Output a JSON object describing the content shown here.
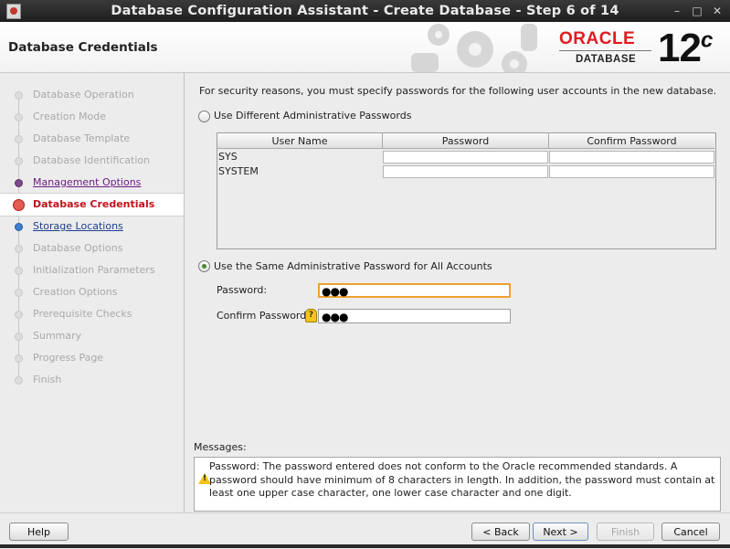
{
  "window": {
    "title": "Database Configuration Assistant - Create Database - Step 6 of 14",
    "controls": {
      "minimize": "–",
      "maximize": "□",
      "close": "✕"
    }
  },
  "header": {
    "page_title": "Database Credentials",
    "brand": {
      "oracle": "ORACLE",
      "database": "DATABASE",
      "version": "12",
      "version_suffix": "c"
    }
  },
  "steps": [
    {
      "label": "Database Operation",
      "state": "disabled"
    },
    {
      "label": "Creation Mode",
      "state": "disabled"
    },
    {
      "label": "Database Template",
      "state": "disabled"
    },
    {
      "label": "Database Identification",
      "state": "disabled"
    },
    {
      "label": "Management Options",
      "state": "visited"
    },
    {
      "label": "Database Credentials",
      "state": "current"
    },
    {
      "label": "Storage Locations",
      "state": "link"
    },
    {
      "label": "Database Options",
      "state": "disabled"
    },
    {
      "label": "Initialization Parameters",
      "state": "disabled"
    },
    {
      "label": "Creation Options",
      "state": "disabled"
    },
    {
      "label": "Prerequisite Checks",
      "state": "disabled"
    },
    {
      "label": "Summary",
      "state": "disabled"
    },
    {
      "label": "Progress Page",
      "state": "disabled"
    },
    {
      "label": "Finish",
      "state": "disabled"
    }
  ],
  "main": {
    "intro": "For security reasons, you must specify passwords for the following user accounts in the new database.",
    "option_different": {
      "label": "Use Different Administrative Passwords",
      "selected": false
    },
    "table": {
      "columns": [
        "User Name",
        "Password",
        "Confirm Password"
      ],
      "rows": [
        {
          "user": "SYS",
          "password": "",
          "confirm": ""
        },
        {
          "user": "SYSTEM",
          "password": "",
          "confirm": ""
        }
      ]
    },
    "option_same": {
      "label": "Use the Same Administrative Password for All Accounts",
      "selected": true
    },
    "password": {
      "label": "Password:",
      "value": "●●●"
    },
    "confirm_password": {
      "label": "Confirm Password",
      "value": "●●●"
    },
    "messages": {
      "label": "Messages:",
      "text": "Password: The password entered does not conform to the Oracle recommended standards. A password should have minimum of 8 characters in length. In addition, the password must contain at least one upper case character, one lower case character and one digit."
    }
  },
  "buttons": {
    "help": "Help",
    "back": "< Back",
    "next": "Next >",
    "finish": "Finish",
    "cancel": "Cancel"
  }
}
